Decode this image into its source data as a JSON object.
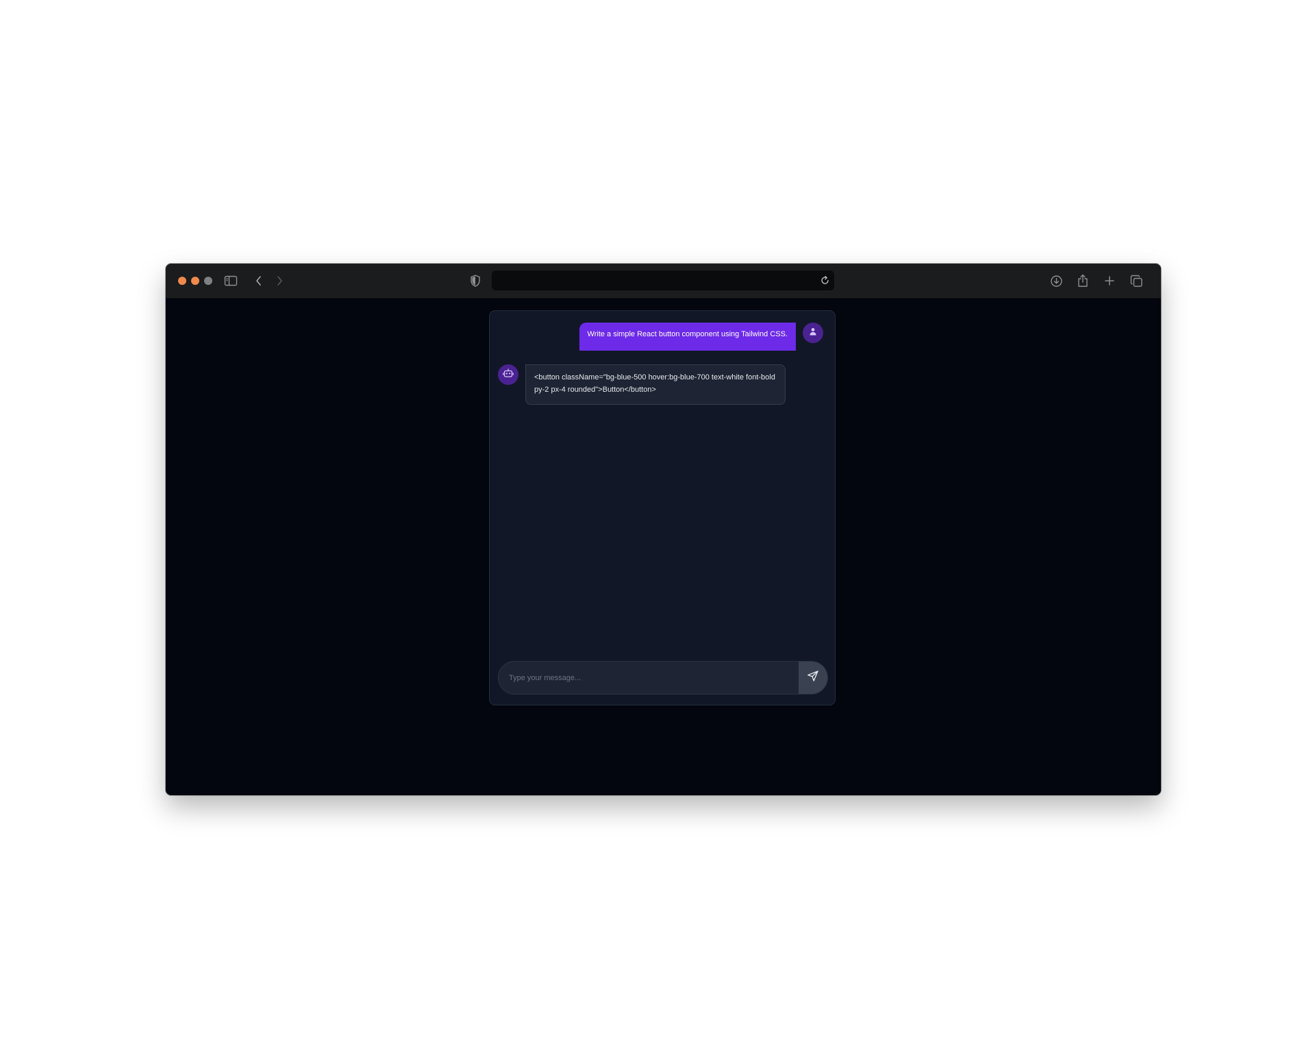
{
  "browser": {
    "traffic_lights": [
      "#ef8a4c",
      "#ef8a4c",
      "#7f8284"
    ],
    "toolbar_icons": [
      "sidebar-icon",
      "back-icon",
      "forward-icon",
      "shield-icon",
      "reload-icon",
      "download-icon",
      "share-icon",
      "new-tab-icon",
      "tabs-overview-icon"
    ],
    "address_value": ""
  },
  "chat": {
    "messages": [
      {
        "role": "user",
        "text": "Write a simple React button component using Tailwind CSS."
      },
      {
        "role": "bot",
        "text": "<button className=\"bg-blue-500 hover:bg-blue-700 text-white font-bold py-2 px-4 rounded\">Button</button>"
      }
    ],
    "input_placeholder": "Type your message...",
    "input_value": "",
    "icons": {
      "user_avatar": "user-icon",
      "bot_avatar": "robot-icon",
      "send": "send-icon"
    },
    "colors": {
      "user_bubble": "#6d2ae9",
      "avatar": "#4a2291",
      "panel": "#111726",
      "bot_bubble": "#1e2433",
      "page": "#03060f"
    }
  }
}
